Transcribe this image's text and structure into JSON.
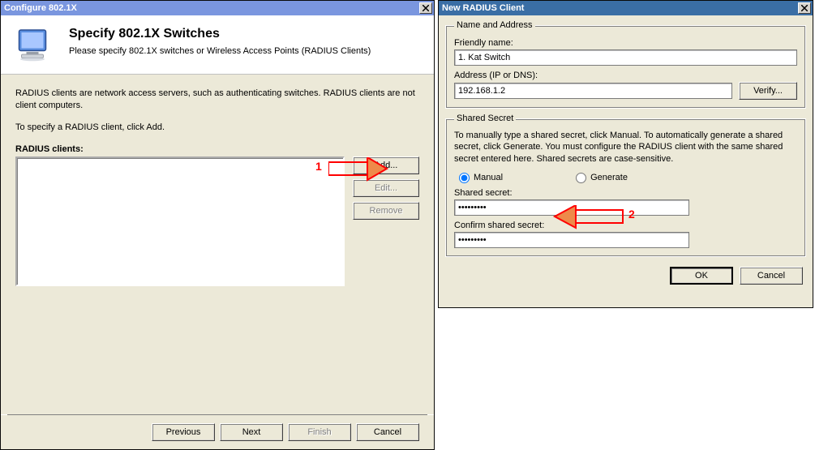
{
  "win1": {
    "title": "Configure 802.1X",
    "heading": "Specify 802.1X Switches",
    "subheading": "Please specify 802.1X switches or Wireless Access Points (RADIUS Clients)",
    "para1": "RADIUS clients are network access servers, such as authenticating switches. RADIUS clients are not client computers.",
    "para2": "To specify a RADIUS client, click Add.",
    "list_label": "RADIUS clients:",
    "btn_add": "Add...",
    "btn_edit": "Edit...",
    "btn_remove": "Remove",
    "footer": {
      "previous": "Previous",
      "next": "Next",
      "finish": "Finish",
      "cancel": "Cancel"
    }
  },
  "win2": {
    "title": "New RADIUS Client",
    "group_name": "Name and Address",
    "friendly_label": "Friendly name:",
    "friendly_value": "1. Kat Switch",
    "addr_label": "Address (IP or DNS):",
    "addr_value": "192.168.1.2",
    "verify": "Verify...",
    "group_secret": "Shared Secret",
    "secret_help": "To manually type a shared secret, click Manual. To automatically generate a shared secret, click Generate. You must configure the RADIUS client with the same shared secret entered here. Shared secrets are case-sensitive.",
    "radio_manual": "Manual",
    "radio_generate": "Generate",
    "secret_label": "Shared secret:",
    "secret_value": "•••••••••",
    "confirm_label": "Confirm shared secret:",
    "confirm_value": "•••••••••",
    "ok": "OK",
    "cancel": "Cancel"
  },
  "annotations": {
    "a1": "1",
    "a2": "2"
  }
}
